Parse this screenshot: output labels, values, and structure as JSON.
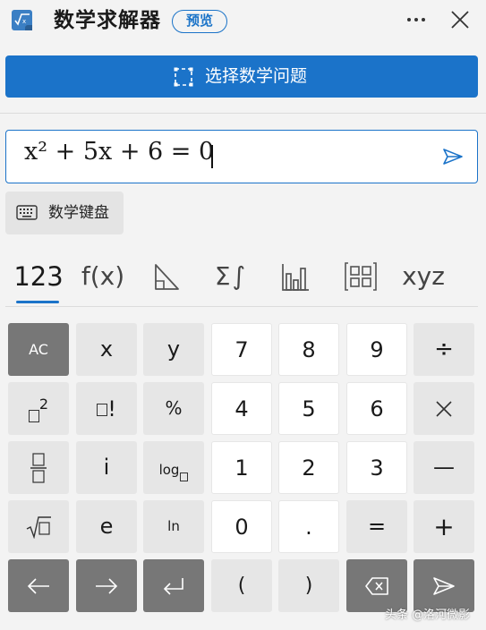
{
  "header": {
    "title": "数学求解器",
    "badge": "预览",
    "app_icon": "math-solver-icon",
    "more_icon": "more-horizontal-icon",
    "close_icon": "close-icon"
  },
  "select_problem": {
    "label": "选择数学问题",
    "icon": "selection-frame-icon"
  },
  "equation_input": {
    "value": "x² + 5x + 6 = 0",
    "submit_icon": "send-arrow-icon"
  },
  "math_keyboard": {
    "label": "数学键盘",
    "icon": "keyboard-icon"
  },
  "tabs": [
    {
      "label": "123",
      "selected": true
    },
    {
      "label": "f(x)"
    },
    {
      "label": "",
      "icon": "geometry-triangle-icon"
    },
    {
      "label": "Σ∫",
      "icon": "sum-integral-icon"
    },
    {
      "label": "",
      "icon": "bar-chart-icon"
    },
    {
      "label": "",
      "icon": "matrix-icon"
    },
    {
      "label": "xyz"
    }
  ],
  "keypad": {
    "rows": [
      [
        "AC",
        "x",
        "y",
        "7",
        "8",
        "9",
        "÷"
      ],
      [
        "□²",
        "□!",
        "%",
        "4",
        "5",
        "6",
        "×"
      ],
      [
        "fraction",
        "i",
        "log□",
        "1",
        "2",
        "3",
        "−"
      ],
      [
        "√□",
        "e",
        "ln",
        "0",
        ".",
        "=",
        "+"
      ],
      [
        "left-arrow",
        "right-arrow",
        "enter",
        "(",
        ")",
        "backspace",
        "submit"
      ]
    ],
    "labels": {
      "ac": "AC",
      "x": "x",
      "y": "y",
      "seven": "7",
      "eight": "8",
      "nine": "9",
      "divide": "÷",
      "square": "2",
      "factorial": "!",
      "percent": "%",
      "four": "4",
      "five": "5",
      "six": "6",
      "multiply": "×",
      "i": "i",
      "log": "log",
      "one": "1",
      "two": "2",
      "three": "3",
      "minus": "—",
      "e": "e",
      "ln": "ln",
      "zero": "0",
      "dot": ".",
      "equals": "=",
      "plus": "+",
      "lparen": "(",
      "rparen": ")"
    },
    "colors": {
      "dark": "#777777",
      "gray": "#e6e6e6",
      "white": "#ffffff"
    }
  },
  "watermark": "头条 @洛河微影",
  "colors": {
    "accent": "#1b73c9",
    "background": "#f3f3f3"
  }
}
